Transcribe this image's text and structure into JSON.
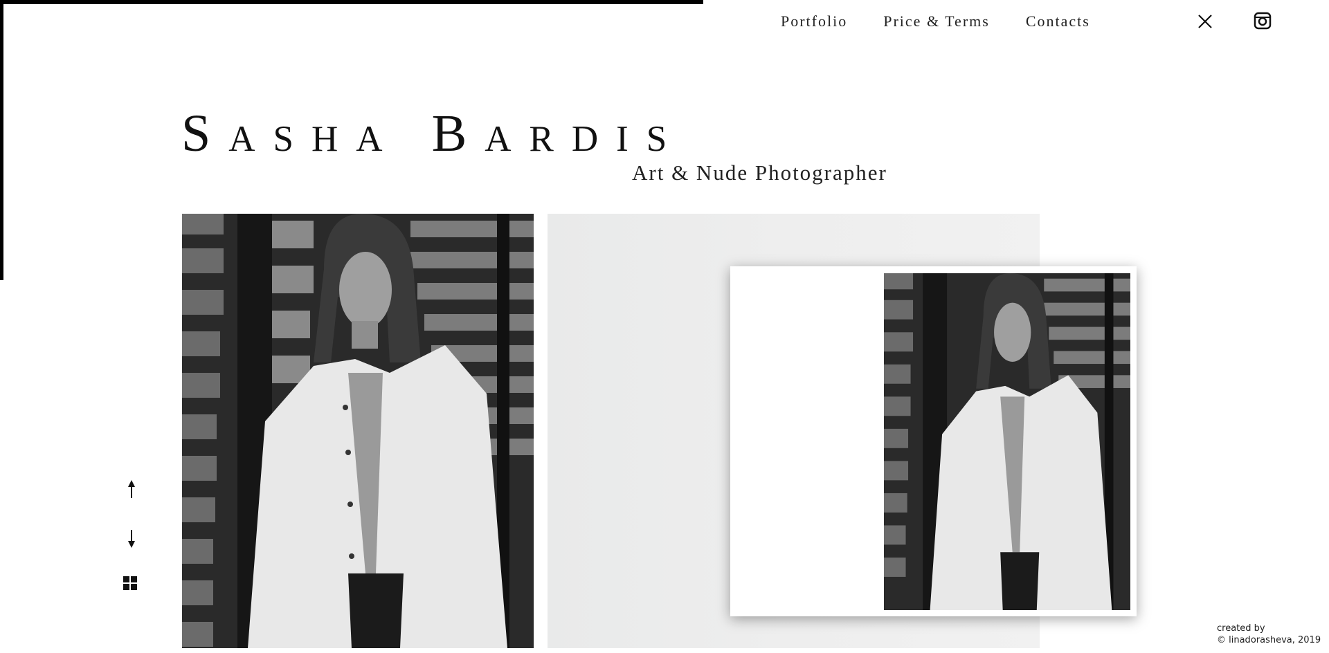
{
  "nav": {
    "items": [
      {
        "label": "Portfolio"
      },
      {
        "label": "Price & Terms"
      },
      {
        "label": "Contacts"
      }
    ],
    "close_icon": "close-icon",
    "social_icon": "instagram-icon"
  },
  "hero": {
    "title": "Sasha Bardis",
    "subtitle": "Art & Nude Photographer"
  },
  "gallery": {
    "main_photo": "portrait-photo",
    "preview_photo": "portrait-photo-preview"
  },
  "controls": {
    "up_icon": "arrow-up-icon",
    "down_icon": "arrow-down-icon",
    "grid_icon": "grid-icon"
  },
  "footer": {
    "line1": "created by",
    "line2": "© linadorasheva, 2019"
  },
  "colors": {
    "background": "#ffffff",
    "text": "#111111",
    "panel": "#eeeeee"
  }
}
